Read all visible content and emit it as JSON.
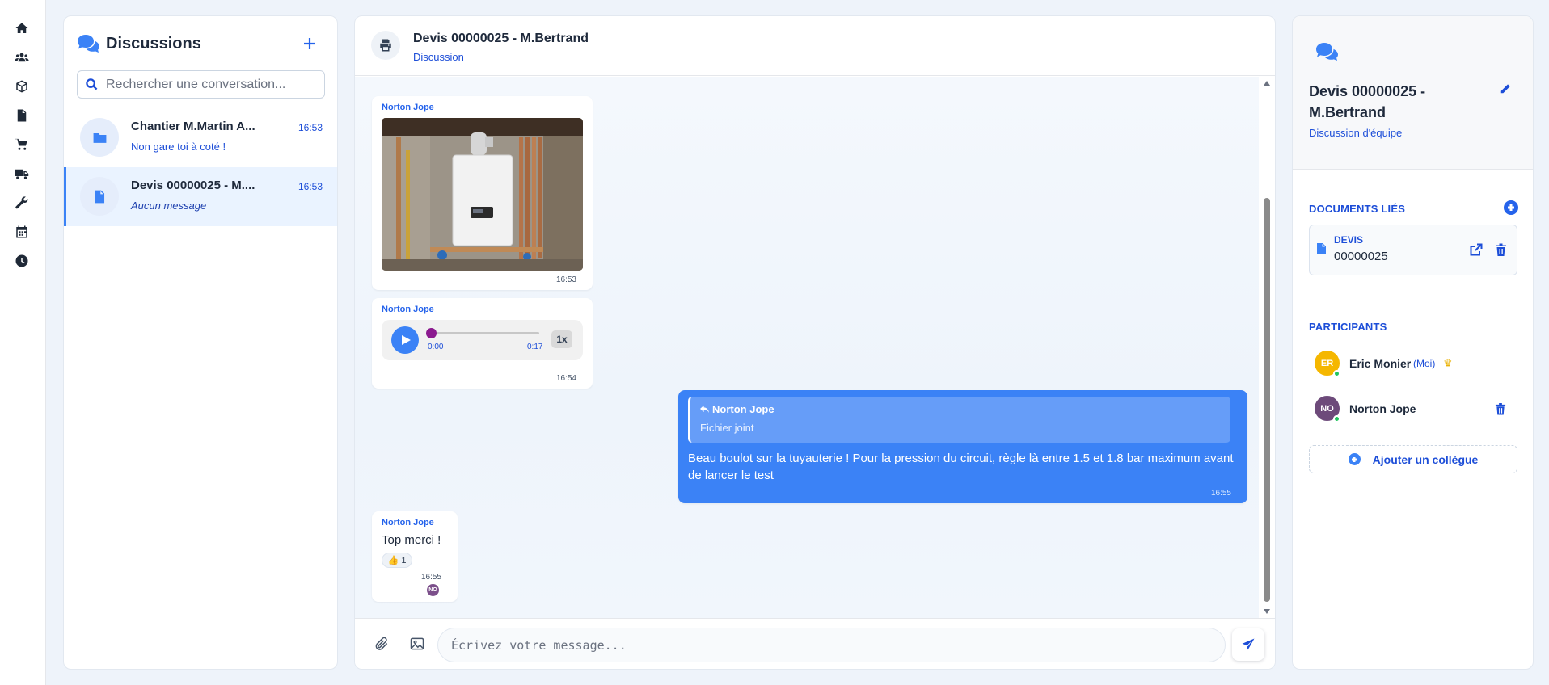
{
  "nav": {
    "items": [
      {
        "icon": "home-icon",
        "label": "Accueil"
      },
      {
        "icon": "users-icon",
        "label": "Clients"
      },
      {
        "icon": "box-icon",
        "label": "Produits"
      },
      {
        "icon": "document-icon",
        "label": "Documents"
      },
      {
        "icon": "cart-icon",
        "label": "Achats"
      },
      {
        "icon": "truck-icon",
        "label": "Livraisons"
      },
      {
        "icon": "wrench-icon",
        "label": "Interventions"
      },
      {
        "icon": "calendar-icon",
        "label": "Planning"
      },
      {
        "icon": "clock-icon",
        "label": "Historique"
      }
    ]
  },
  "conversations": {
    "title": "Discussions",
    "search_placeholder": "Rechercher une conversation...",
    "items": [
      {
        "name": "Chantier M.Martin A...",
        "time": "16:53",
        "preview": "Non gare toi à coté !",
        "icon": "folder-icon",
        "active": false
      },
      {
        "name": "Devis 00000025 - M....",
        "time": "16:53",
        "preview": "Aucun message",
        "icon": "document-icon",
        "active": true
      }
    ]
  },
  "chat": {
    "title": "Devis 00000025 - M.Bertrand",
    "subtitle": "Discussion",
    "messages": [
      {
        "type": "image",
        "author": "Norton Jope",
        "time": "16:53",
        "image": "boiler-photo"
      },
      {
        "type": "audio",
        "author": "Norton Jope",
        "time": "16:54",
        "current": "0:00",
        "duration": "0:17",
        "speed": "1x",
        "progress": 0
      },
      {
        "type": "reply",
        "reply_to": "Norton Jope",
        "reply_preview": "Fichier joint",
        "text": "Beau boulot sur la tuyauterie ! Pour la pression du circuit, règle là entre 1.5 et 1.8 bar maximum avant de lancer le test",
        "time": "16:55"
      },
      {
        "type": "text",
        "author": "Norton Jope",
        "text": "Top merci !",
        "reaction": "👍 1",
        "time": "16:55",
        "read_by": "NO"
      }
    ],
    "composer_placeholder": "Écrivez votre message..."
  },
  "details": {
    "title": "Devis 00000025 - M.Bertrand",
    "subtitle": "Discussion d'équipe",
    "documents_label": "DOCUMENTS LIÉS",
    "documents": [
      {
        "type": "DEVIS",
        "number": "00000025"
      }
    ],
    "participants_label": "PARTICIPANTS",
    "participants": [
      {
        "initials": "ER",
        "name": "Eric Monier",
        "tag": "(Moi)",
        "owner": true,
        "color": "#f5b700",
        "online": true
      },
      {
        "initials": "NO",
        "name": "Norton Jope",
        "tag": "",
        "owner": false,
        "color": "#6d4a7a",
        "online": true
      }
    ],
    "add_colleague_label": "Ajouter un collègue"
  },
  "colors": {
    "accent": "#3b82f6",
    "accent_dark": "#1d4ed8",
    "audio_knob": "#8b1a8f",
    "online": "#22c55e"
  }
}
